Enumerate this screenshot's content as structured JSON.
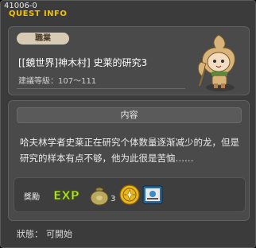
{
  "header": {
    "quest_id": "41006-0",
    "title": "QUEST INFO"
  },
  "quest": {
    "job_badge": "職業",
    "name": "[[鏡世界]神木村] 史莱的研究3",
    "level_label": "建議等級：",
    "level_range": "107～111"
  },
  "content": {
    "header": "内容",
    "description": "哈夫林学者史莱正在研究个体数量逐渐减少的龙，但是研究的样本有点不够，他为此很是苦恼……"
  },
  "rewards": {
    "label": "獎勵",
    "exp_text": "EXP",
    "coin_qty": "3",
    "items": [
      "exp-reward",
      "money-bag-reward",
      "coin-reward",
      "box-reward"
    ]
  },
  "status": {
    "label": "狀態：",
    "value": "可開始"
  },
  "colors": {
    "title": "#f2c200",
    "badge_bg": "#d8cbb4",
    "panel_bg": "#4a4a4a",
    "window_bg": "#3b3b3b"
  }
}
